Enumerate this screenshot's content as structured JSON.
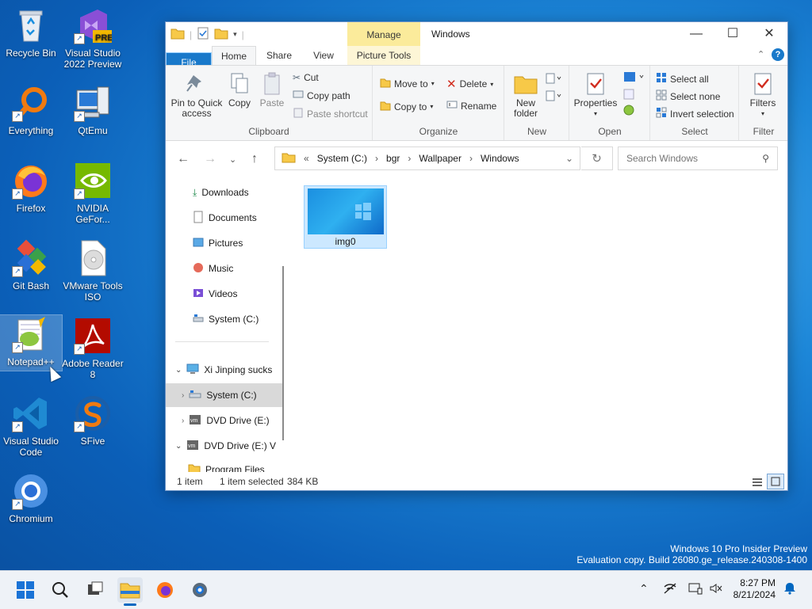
{
  "desktop": {
    "icons": [
      {
        "label": "Recycle Bin",
        "icon": "recycle-bin-icon"
      },
      {
        "label": "Visual Studio 2022 Preview",
        "icon": "visual-studio-icon",
        "badge": "PRE"
      },
      {
        "label": "Everything",
        "icon": "search-magnifier-icon"
      },
      {
        "label": "QtEmu",
        "icon": "computer-icon"
      },
      {
        "label": "Firefox",
        "icon": "firefox-icon"
      },
      {
        "label": "NVIDIA GeFor...",
        "icon": "nvidia-icon"
      },
      {
        "label": "Git Bash",
        "icon": "git-icon"
      },
      {
        "label": "VMware Tools ISO",
        "icon": "disc-icon"
      },
      {
        "label": "Notepad++",
        "icon": "notepad-plus-icon"
      },
      {
        "label": "Adobe Reader 8",
        "icon": "adobe-reader-icon"
      },
      {
        "label": "Visual Studio Code",
        "icon": "vscode-icon"
      },
      {
        "label": "SFive",
        "icon": "sfive-icon"
      },
      {
        "label": "Chromium",
        "icon": "chromium-icon"
      }
    ],
    "watermark_line1": "Windows 10 Pro Insider Preview",
    "watermark_line2": "Evaluation copy. Build 26080.ge_release.240308-1400"
  },
  "window": {
    "title": "Windows",
    "contextual_tab": "Manage",
    "tabs": {
      "file": "File",
      "home": "Home",
      "share": "Share",
      "view": "View",
      "picture_tools": "Picture Tools"
    },
    "ribbon": {
      "clipboard": {
        "label": "Clipboard",
        "pin": "Pin to Quick access",
        "copy": "Copy",
        "paste": "Paste",
        "cut": "Cut",
        "copy_path": "Copy path",
        "paste_shortcut": "Paste shortcut"
      },
      "organize": {
        "label": "Organize",
        "move_to": "Move to",
        "copy_to": "Copy to",
        "delete": "Delete",
        "rename": "Rename"
      },
      "new": {
        "label": "New",
        "new_folder": "New folder"
      },
      "open": {
        "label": "Open",
        "properties": "Properties"
      },
      "select": {
        "label": "Select",
        "select_all": "Select all",
        "select_none": "Select none",
        "invert": "Invert selection"
      },
      "filter": {
        "label": "Filter",
        "filters": "Filters"
      }
    },
    "breadcrumb": {
      "overflow": "«",
      "parts": [
        "System (C:)",
        "bgr",
        "Wallpaper",
        "Windows"
      ]
    },
    "search_placeholder": "Search Windows",
    "nav": [
      {
        "label": "Downloads",
        "pinned": true
      },
      {
        "label": "Documents",
        "pinned": true
      },
      {
        "label": "Pictures",
        "pinned": true
      },
      {
        "label": "Music",
        "pinned": true
      },
      {
        "label": "Videos",
        "pinned": true
      },
      {
        "label": "System (C:)",
        "pinned": false
      },
      {
        "label": "Xi Jinping sucks"
      },
      {
        "label": "System (C:)"
      },
      {
        "label": "DVD Drive (E:)"
      },
      {
        "label": "DVD Drive (E:) V"
      },
      {
        "label": "Program Files"
      }
    ],
    "files": [
      {
        "name": "img0"
      }
    ],
    "status": {
      "count": "1 item",
      "selected": "1 item selected",
      "size": "384 KB"
    }
  },
  "taskbar": {
    "time": "8:27 PM",
    "date": "8/21/2024"
  },
  "colors": {
    "accent": "#1979ca",
    "selection": "#cce8ff",
    "manage_tab": "#fbeb9b"
  }
}
